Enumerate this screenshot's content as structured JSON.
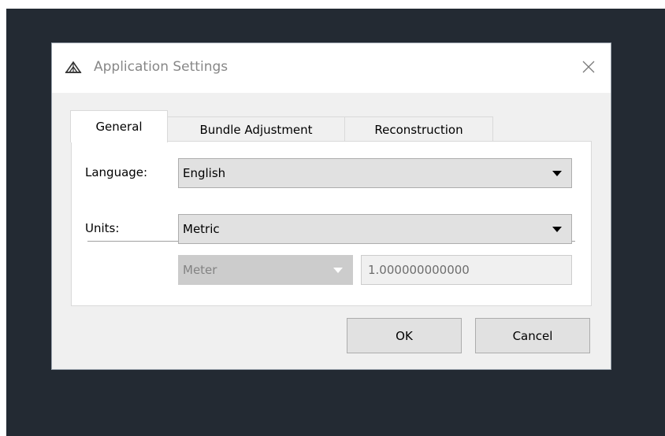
{
  "dialog": {
    "title": "Application Settings",
    "icon": "photogrammetry-app-icon",
    "close_icon": "close-icon"
  },
  "tabs": [
    {
      "label": "General",
      "active": true
    },
    {
      "label": "Bundle Adjustment",
      "active": false
    },
    {
      "label": "Reconstruction",
      "active": false
    }
  ],
  "general": {
    "language_label": "Language:",
    "language_value": "English",
    "units_label": "Units:",
    "units_value": "Metric",
    "unit_value": "Meter",
    "unit_enabled": false,
    "scale_value": "1.000000000000",
    "scale_enabled": false
  },
  "buttons": {
    "ok_label": "OK",
    "cancel_label": "Cancel"
  },
  "colors": {
    "backdrop": "#232a33",
    "dialog_bg": "#f0f0f0",
    "titlebar_bg": "#ffffff",
    "button_bg": "#e1e1e1"
  }
}
